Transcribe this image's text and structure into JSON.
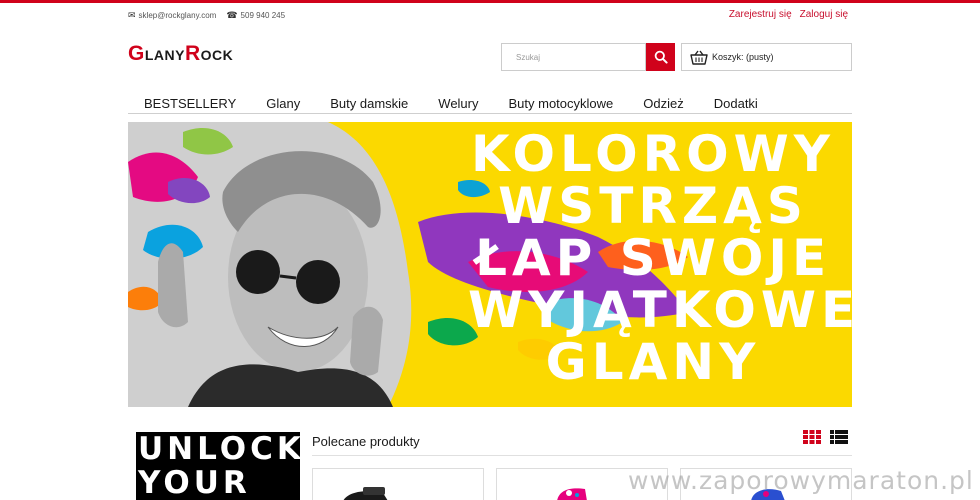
{
  "topbar": {
    "email": "sklep@rockglany.com",
    "phone": "509 940 245",
    "register_label": "Zarejestruj się",
    "login_label": "Zaloguj się"
  },
  "logo": {
    "part1_initial": "G",
    "part1_rest": "LANY",
    "part2_initial": "R",
    "part2_rest": "OCK"
  },
  "search": {
    "placeholder": "Szukaj"
  },
  "cart": {
    "label": "Koszyk: (pusty)"
  },
  "nav": {
    "items": [
      {
        "label": "BESTSELLERY"
      },
      {
        "label": "Glany"
      },
      {
        "label": "Buty damskie"
      },
      {
        "label": "Welury"
      },
      {
        "label": "Buty motocyklowe"
      },
      {
        "label": "Odzież"
      },
      {
        "label": "Dodatki"
      }
    ]
  },
  "banner": {
    "line1": "KOLOROWY",
    "line2": "WSTRZĄS",
    "line3": "ŁAP SWOJE",
    "line4": "WYJĄTKOWE",
    "line5": "GLANY"
  },
  "promo": {
    "line1": "UNLOCK",
    "line2": "YOUR"
  },
  "products_section": {
    "title": "Polecane produkty"
  },
  "watermark": "www.zaporowymaraton.pl",
  "colors": {
    "brand_red": "#d0021b",
    "banner_yellow": "#fbd900"
  },
  "icons": [
    "envelope-icon",
    "phone-icon",
    "search-icon",
    "cart-icon",
    "grid-view-icon",
    "list-view-icon"
  ]
}
